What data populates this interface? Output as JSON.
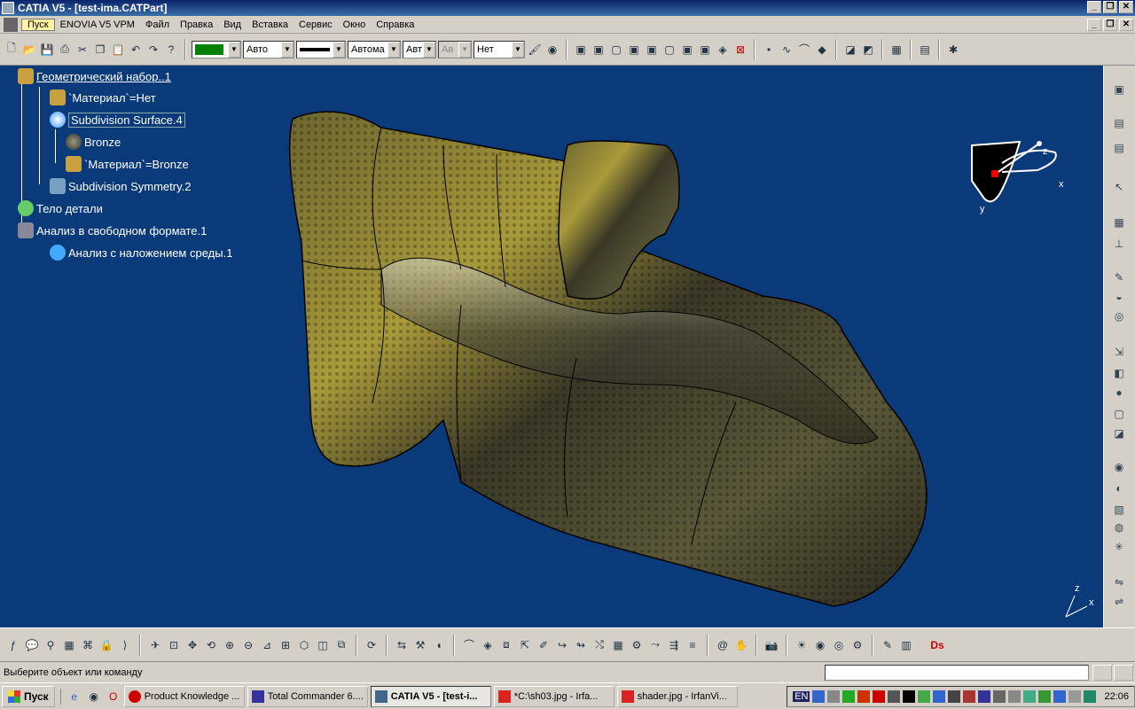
{
  "window": {
    "title": "CATIA V5 - [test-ima.CATPart]",
    "min": "_",
    "restore": "❐",
    "close": "✕"
  },
  "menu": {
    "items": [
      "Пуск",
      "ENOVIA V5 VPM",
      "Файл",
      "Правка",
      "Вид",
      "Вставка",
      "Сервис",
      "Окно",
      "Справка"
    ]
  },
  "toolbar": {
    "color_value": "",
    "line_type": "Авто",
    "line_weight": "",
    "point_style": "Автома",
    "layer1": "Авт",
    "layer2": "Ав",
    "layer3": "Нет",
    "color_accent": "#008000"
  },
  "tree": {
    "items": [
      {
        "label": "Геометрический набор..1",
        "icon": "geometric-set-icon"
      },
      {
        "label": "`Материал`=Нет",
        "icon": "material-param-icon"
      },
      {
        "label": "Subdivision Surface.4",
        "icon": "subdivision-surface-icon"
      },
      {
        "label": "Bronze",
        "icon": "bronze-material-icon"
      },
      {
        "label": "`Материал`=Bronze",
        "icon": "material-param-icon"
      },
      {
        "label": "Subdivision Symmetry.2",
        "icon": "symmetry-icon"
      },
      {
        "label": "Тело детали",
        "icon": "part-body-icon"
      },
      {
        "label": "Анализ в свободном формате.1",
        "icon": "freestyle-analysis-icon"
      },
      {
        "label": "Анализ с наложением среды.1",
        "icon": "environment-mapping-icon"
      }
    ]
  },
  "compass": {
    "x": "x",
    "y": "y",
    "z": "z"
  },
  "axis_indicator": {
    "x": "x",
    "z": "z"
  },
  "status": {
    "prompt": "Выберите объект или команду"
  },
  "taskbar": {
    "start": "Пуск",
    "tasks": [
      {
        "label": "Product Knowledge ...",
        "active": false
      },
      {
        "label": "Total Commander 6....",
        "active": false
      },
      {
        "label": "CATIA V5 - [test-i...",
        "active": true
      },
      {
        "label": "*C:\\sh03.jpg - Irfa...",
        "active": false
      },
      {
        "label": "shader.jpg - IrfanVi...",
        "active": false
      }
    ],
    "lang": "EN",
    "clock": "22:06"
  }
}
